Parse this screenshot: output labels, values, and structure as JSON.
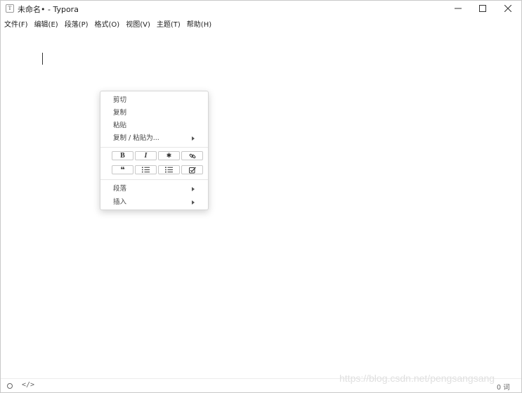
{
  "window": {
    "app_icon_glyph": "T",
    "title": "未命名• - Typora",
    "minimize_icon": "minimize-icon",
    "maximize_icon": "maximize-icon",
    "close_icon": "close-icon"
  },
  "menu": {
    "items": [
      {
        "label": "文件(F)"
      },
      {
        "label": "编辑(E)"
      },
      {
        "label": "段落(P)"
      },
      {
        "label": "格式(O)"
      },
      {
        "label": "视图(V)"
      },
      {
        "label": "主题(T)"
      },
      {
        "label": "帮助(H)"
      }
    ]
  },
  "context_menu": {
    "cut": "剪切",
    "copy": "复制",
    "paste": "粘贴",
    "copy_paste_as": "复制 / 粘贴为...",
    "format_buttons": {
      "bold": "B",
      "italic": "I",
      "code": "✱",
      "link_icon": "link-icon",
      "quote": "❝",
      "ordered_list_icon": "ordered-list-icon",
      "unordered_list_icon": "unordered-list-icon",
      "task_list_icon": "task-list-icon"
    },
    "paragraph": "段落",
    "insert": "插入"
  },
  "statusbar": {
    "outline_icon": "circle-icon",
    "source_mode_label": "</>",
    "word_count": "0 词"
  },
  "watermark": "https://blog.csdn.net/pengsangsang"
}
